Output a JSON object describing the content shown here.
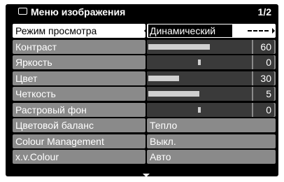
{
  "header": {
    "title": "Меню изображения",
    "page": "1/2",
    "icon": "menu-icon"
  },
  "rows": [
    {
      "label": "Режим просмотра",
      "type": "select",
      "value": "Динамический"
    },
    {
      "label": "Контраст",
      "type": "slider",
      "value": "60",
      "level": 0.6
    },
    {
      "label": "Яркость",
      "type": "center-slider",
      "value": "0",
      "level": 0.5
    },
    {
      "label": "Цвет",
      "type": "slider",
      "value": "30",
      "level": 0.3
    },
    {
      "label": "Четкость",
      "type": "slider",
      "value": "5",
      "level": 0.5
    },
    {
      "label": "Растровый фон",
      "type": "center-slider",
      "value": "0",
      "level": 0.5
    },
    {
      "label": "Цветовой баланс",
      "type": "text",
      "value": "Тепло"
    },
    {
      "label": "Colour Management",
      "type": "text",
      "value": "Выкл."
    },
    {
      "label": "x.v.Colour",
      "type": "text",
      "value": "Авто"
    }
  ]
}
